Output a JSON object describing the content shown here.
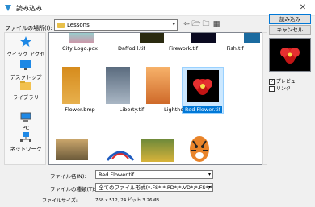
{
  "window": {
    "title": "読み込み",
    "close_glyph": "✕"
  },
  "location": {
    "label": "ファイルの場所(I):",
    "value": "Lessons"
  },
  "toolbar": {
    "back_glyph": "⇦",
    "up_glyph": "🗁",
    "new_folder_glyph": "🗀",
    "view_glyph": "▦"
  },
  "buttons": {
    "open": "読み込み",
    "cancel": "キャンセル"
  },
  "places": [
    {
      "label": "クイック アクセス",
      "icon": "star-icon"
    },
    {
      "label": "デスクトップ",
      "icon": "desktop-icon"
    },
    {
      "label": "ライブラリ",
      "icon": "library-icon"
    },
    {
      "label": "PC",
      "icon": "pc-icon"
    },
    {
      "label": "ネットワーク",
      "icon": "network-icon"
    }
  ],
  "files": [
    {
      "name": "City Logo.pcx"
    },
    {
      "name": "Daffodil.tif"
    },
    {
      "name": "Firework.tif"
    },
    {
      "name": "Fish.tif"
    },
    {
      "name": "Flower.bmp"
    },
    {
      "name": "Liberty.tif"
    },
    {
      "name": "Lighthouse.jpg"
    },
    {
      "name": "Red Flower.tif",
      "selected": true
    }
  ],
  "options": {
    "preview": "プレビュー",
    "link": "リンク"
  },
  "filename": {
    "label": "ファイル名(N):",
    "value": "Red Flower.tif"
  },
  "filetype": {
    "label": "ファイルの種類(T):",
    "value": "全てのファイル形式(*.FS*;*.PD*;*.VD*;*.FS*;*.PD*;*.PD*;*Dx"
  },
  "filesize": {
    "label": "ファイルサイズ:",
    "value": "768 x 512, 24 ビット 3.26MB"
  }
}
